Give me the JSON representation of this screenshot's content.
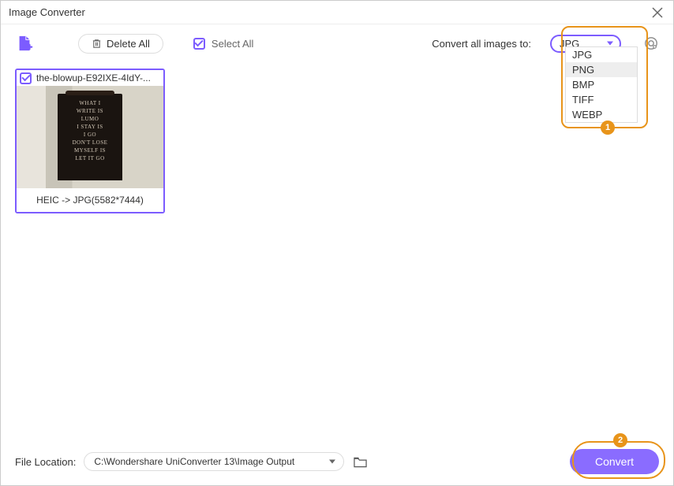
{
  "window": {
    "title": "Image Converter"
  },
  "toolbar": {
    "delete_all_label": "Delete All",
    "select_all_label": "Select All",
    "select_all_checked": true,
    "convert_to_label": "Convert all images to:",
    "format_selected": "JPG",
    "format_options": [
      "JPG",
      "PNG",
      "BMP",
      "TIFF",
      "WEBP"
    ],
    "format_highlight": "PNG"
  },
  "images": [
    {
      "filename": "the-blowup-E92IXE-4IdY-...",
      "checked": true,
      "conversion_info": "HEIC -> JPG(5582*7444)"
    }
  ],
  "footer": {
    "file_location_label": "File Location:",
    "file_location_path": "C:\\Wondershare UniConverter 13\\Image Output",
    "convert_button_label": "Convert"
  },
  "annotations": {
    "badge1": "1",
    "badge2": "2"
  }
}
